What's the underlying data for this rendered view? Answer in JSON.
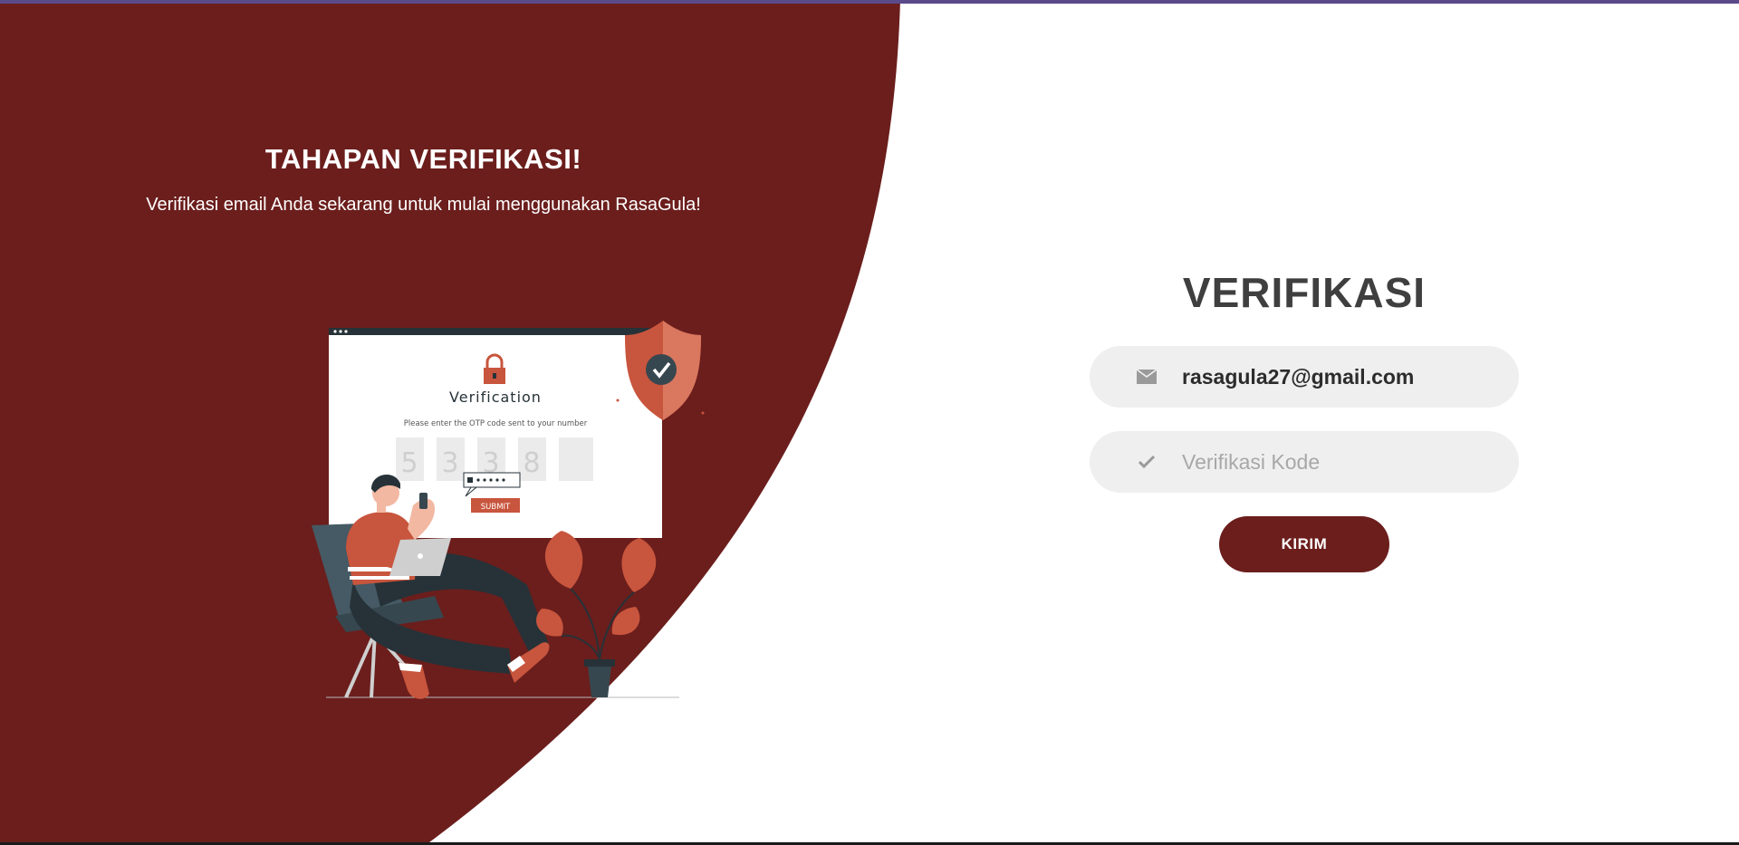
{
  "left": {
    "title": "TAHAPAN VERIFIKASI!",
    "subtitle": "Verifikasi email Anda sekarang untuk mulai menggunakan RasaGula!"
  },
  "illustration": {
    "card_title": "Verification",
    "card_text": "Please enter the OTP code sent to your number",
    "otp_digits": [
      "5",
      "3",
      "3",
      "8",
      ""
    ],
    "submit_label": "SUBMIT"
  },
  "form": {
    "title": "VERIFIKASI",
    "email_value": "rasagula27@gmail.com",
    "code_placeholder": "Verifikasi Kode",
    "submit_label": "KIRIM"
  },
  "colors": {
    "panel": "#6b1e1c",
    "accent": "#c8553d",
    "field_bg": "#efefef",
    "title": "#3f3f3f"
  },
  "icons": {
    "email": "envelope-icon",
    "code": "check-icon"
  }
}
